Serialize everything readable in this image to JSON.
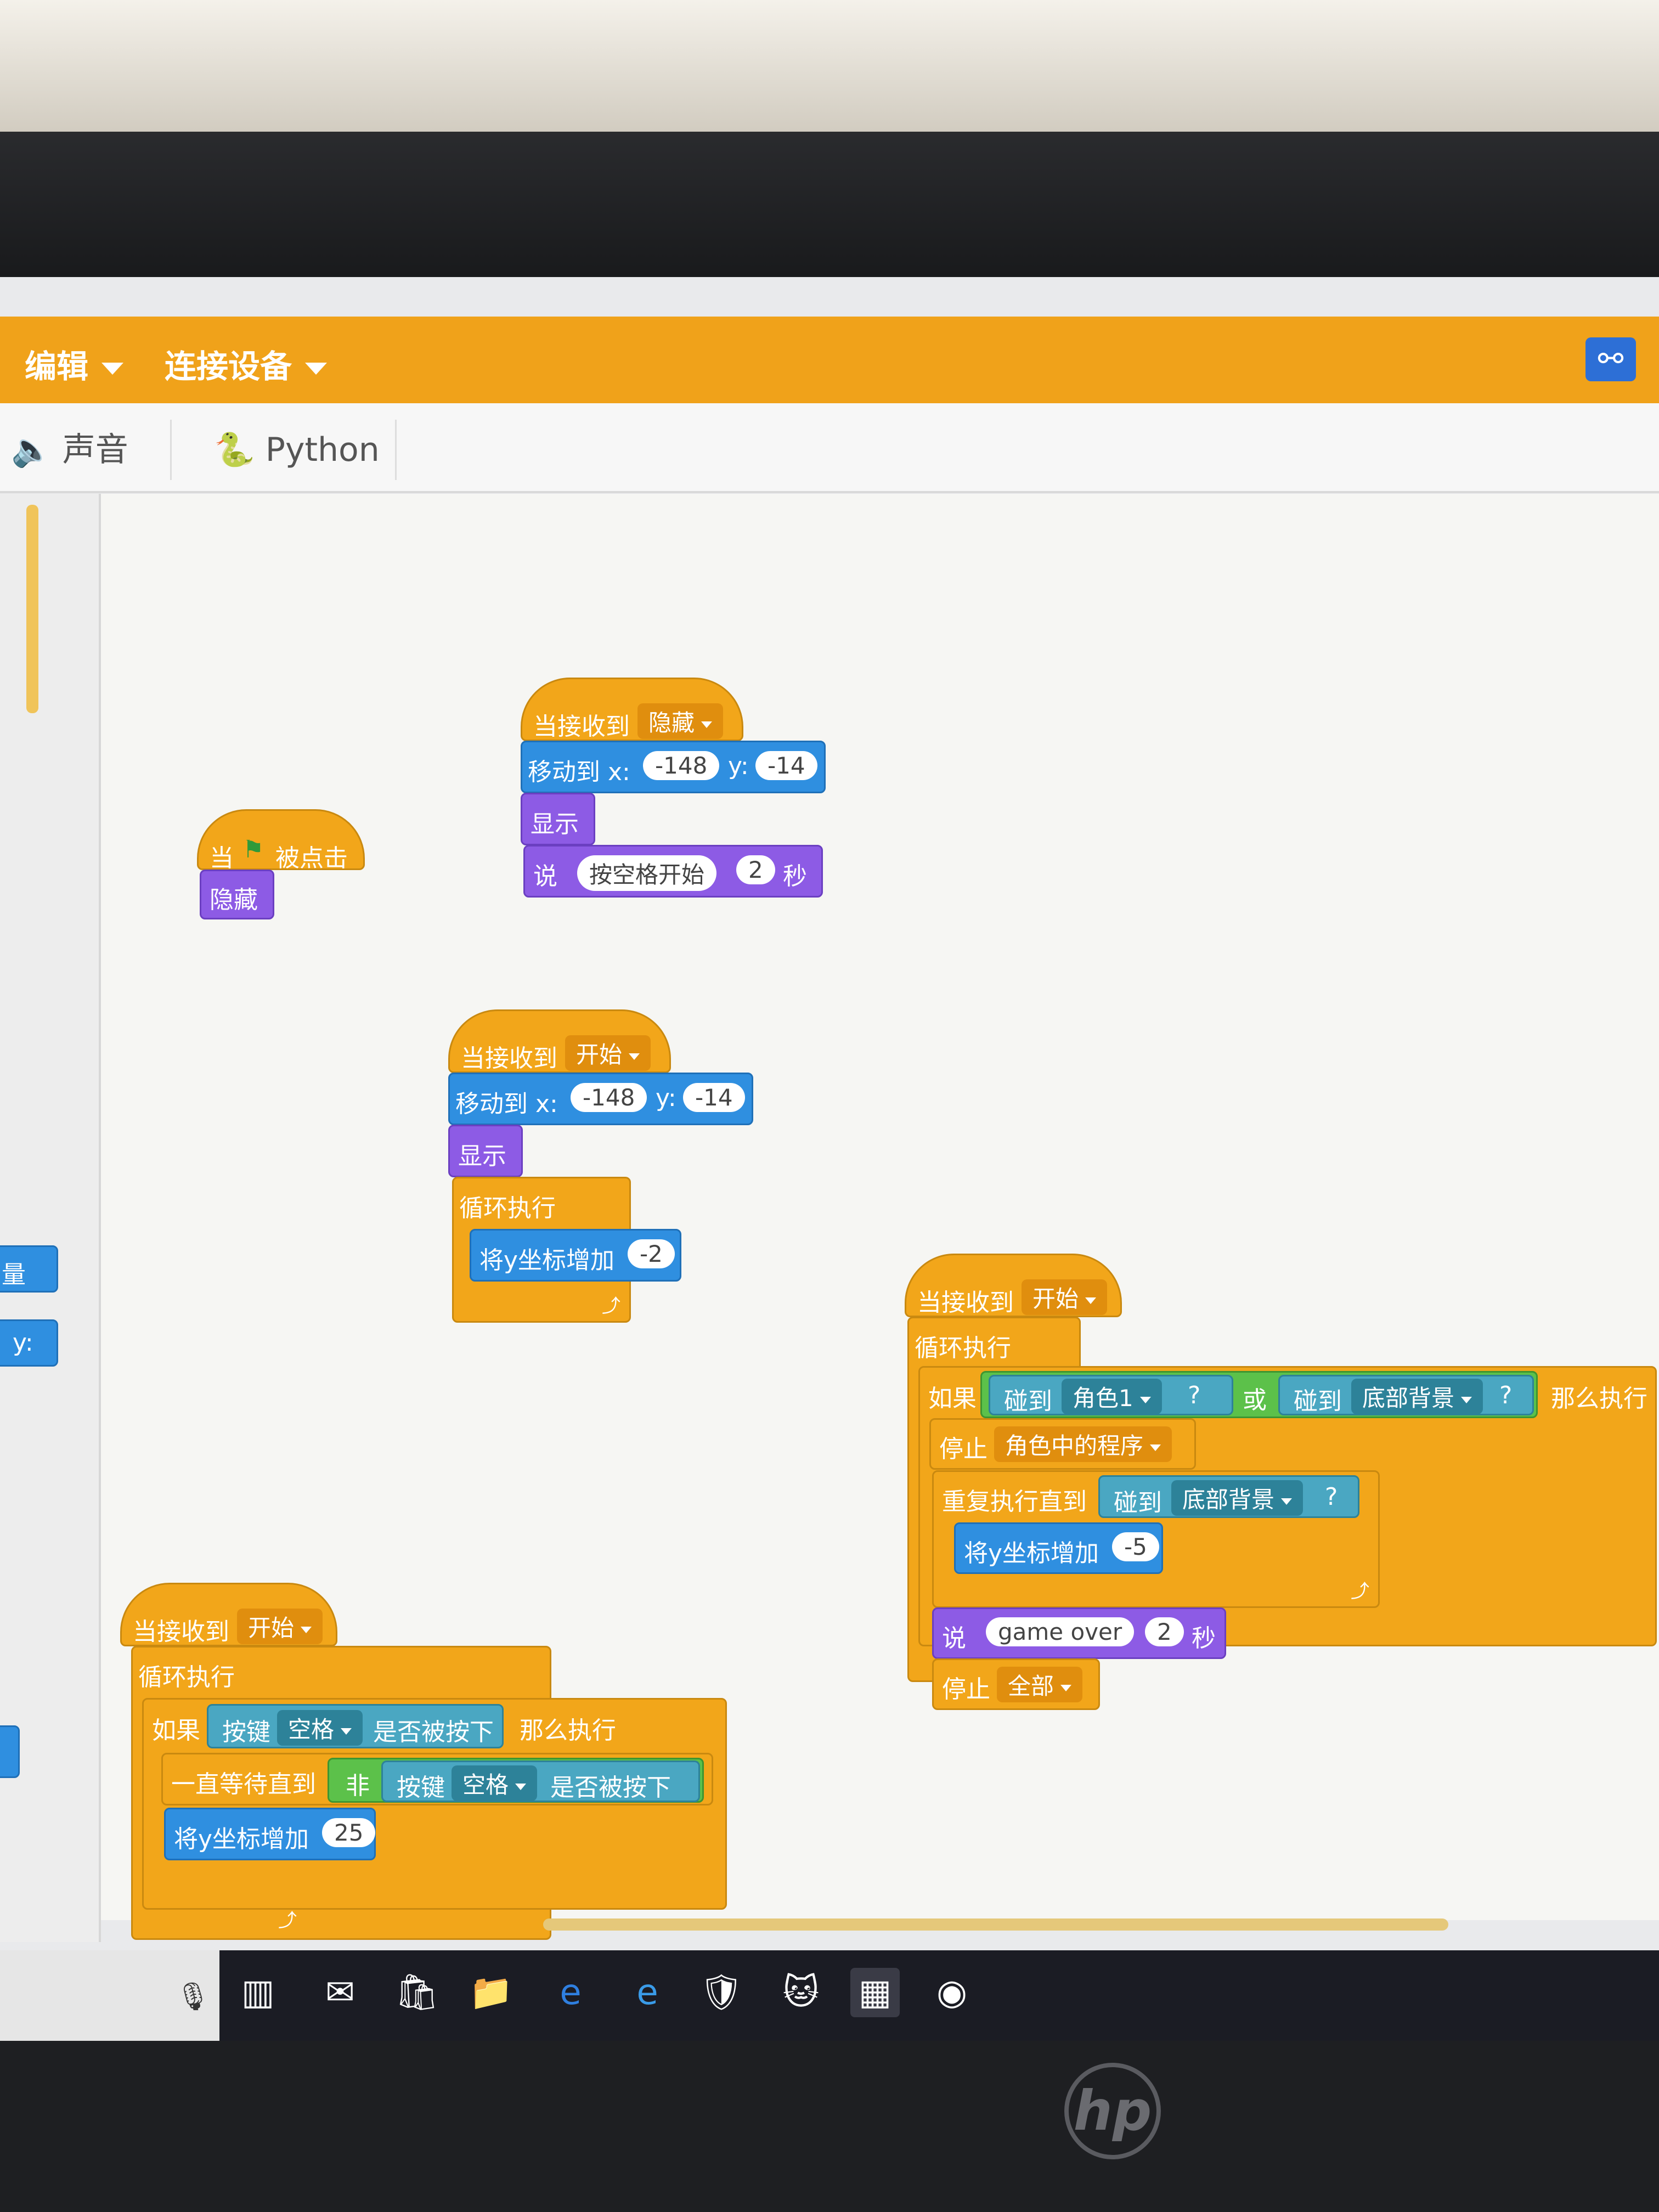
{
  "menu": {
    "edit": "编辑",
    "connect": "连接设备"
  },
  "tabs": {
    "sound": "声音",
    "python": "Python"
  },
  "scripts": {
    "s1": {
      "hat": "当接收到",
      "msg": "隐藏",
      "move": "移动到 x:",
      "x": "-148",
      "y_lbl": "y:",
      "y": "-14",
      "show": "显示",
      "say": "说",
      "say_text": "按空格开始",
      "say_secs": "2",
      "secs_lbl": "秒"
    },
    "s2": {
      "hat_a": "当",
      "hat_b": "被点击",
      "hide": "隐藏"
    },
    "s3": {
      "hat": "当接收到",
      "msg": "开始",
      "move": "移动到 x:",
      "x": "-148",
      "y_lbl": "y:",
      "y": "-14",
      "show": "显示",
      "loop": "循环执行",
      "change": "将y坐标增加",
      "val": "-2"
    },
    "s4": {
      "hat": "当接收到",
      "msg": "开始",
      "loop": "循环执行",
      "if": "如果",
      "key": "按键",
      "key_val": "空格",
      "pressed": "是否被按下",
      "then": "那么执行",
      "wait": "一直等待直到",
      "not": "非",
      "change": "将y坐标增加",
      "val": "25"
    },
    "s5": {
      "hat": "当接收到",
      "msg": "开始",
      "loop": "循环执行",
      "if": "如果",
      "touch": "碰到",
      "sprite": "角色1",
      "q": "?",
      "or": "或",
      "bg": "底部背景",
      "then": "那么执行",
      "stop": "停止",
      "stop_val": "角色中的程序",
      "repeat": "重复执行直到",
      "change": "将y坐标增加",
      "val": "-5",
      "say": "说",
      "say_text": "game over",
      "say_secs": "2",
      "secs_lbl": "秒",
      "stop_all": "全部"
    }
  },
  "palette_fragments": {
    "drop": "量",
    "y": "y:"
  },
  "colors": {
    "event": "#f2a61a",
    "motion": "#2f8fe0",
    "looks": "#8d5be5",
    "sensing": "#4aa7c2",
    "operator": "#5cc14a"
  },
  "icons": [
    "speaker-icon",
    "python-icon",
    "flag-icon",
    "taskbar-icons"
  ]
}
